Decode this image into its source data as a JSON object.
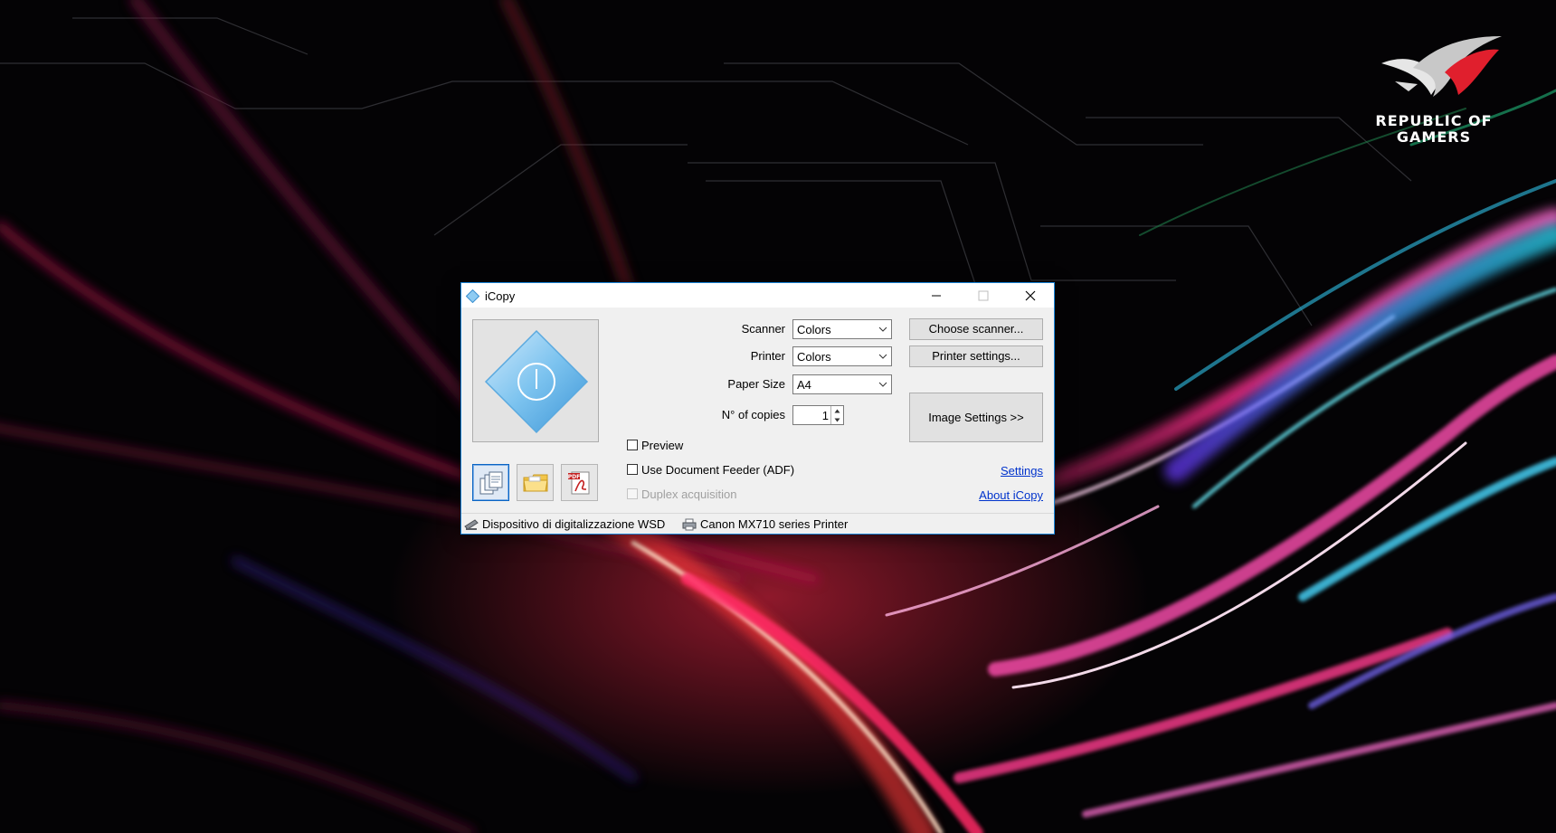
{
  "desktop": {
    "brand_line1": "REPUBLIC OF",
    "brand_line2": "GAMERS"
  },
  "window": {
    "title": "iCopy",
    "icon": "icopy-diamond-icon"
  },
  "form": {
    "scanner_label": "Scanner",
    "scanner_value": "Colors",
    "printer_label": "Printer",
    "printer_value": "Colors",
    "paper_label": "Paper Size",
    "paper_value": "A4",
    "copies_label": "N° of copies",
    "copies_value": "1"
  },
  "buttons": {
    "choose_scanner": "Choose scanner...",
    "printer_settings": "Printer settings...",
    "image_settings": "Image Settings >>"
  },
  "options": {
    "preview": "Preview",
    "adf": "Use Document Feeder (ADF)",
    "duplex": "Duplex acquisition"
  },
  "links": {
    "settings": "Settings",
    "about": "About iCopy"
  },
  "status": {
    "scanner": "Dispositivo di digitalizzazione WSD",
    "printer": "Canon MX710 series Printer"
  },
  "tools": [
    "copy-icon",
    "folder-icon",
    "pdf-icon"
  ],
  "colors": {
    "accent": "#1883d7",
    "link": "#0033cc"
  }
}
